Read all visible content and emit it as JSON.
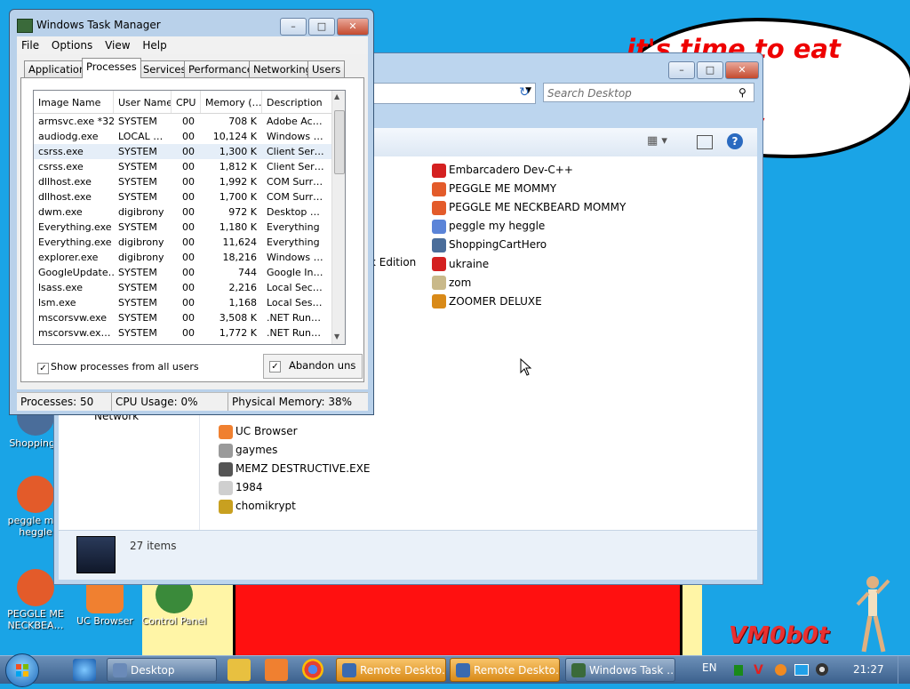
{
  "desktop": {
    "bubble_text": "it's time to eat shit\nand chew\ngum",
    "signature": "VM0b0t",
    "icons": [
      {
        "label": "ShoppingC"
      },
      {
        "label": "peggle m… heggle"
      },
      {
        "label": "PEGGLE ME NECKBEA…"
      },
      {
        "label": "UC Browser"
      },
      {
        "label": "Control Panel"
      }
    ]
  },
  "explorer": {
    "search_placeholder": "Search Desktop",
    "partial_text": "k Edition",
    "nav_network": "Network",
    "items_right": [
      {
        "label": "Embarcadero Dev-C++",
        "color": "#d42020"
      },
      {
        "label": "PEGGLE ME MOMMY",
        "color": "#e35b2a"
      },
      {
        "label": "PEGGLE ME NECKBEARD MOMMY",
        "color": "#e35b2a"
      },
      {
        "label": "peggle my heggle",
        "color": "#5b84d8"
      },
      {
        "label": "ShoppingCartHero",
        "color": "#4a6d9a"
      },
      {
        "label": "ukraine",
        "color": "#d42020"
      },
      {
        "label": "zom",
        "color": "#c9b98a"
      },
      {
        "label": "ZOOMER DELUXE",
        "color": "#d98a18"
      }
    ],
    "items_bottom": [
      {
        "label": "UC Browser",
        "color": "#f08030"
      },
      {
        "label": "gaymes",
        "color": "#9a9a9a"
      },
      {
        "label": "MEMZ DESTRUCTIVE.EXE",
        "color": "#555555"
      },
      {
        "label": "1984",
        "color": "#cfcfcf"
      },
      {
        "label": "chomikrypt",
        "color": "#c8a020"
      }
    ],
    "item_count": "27 items"
  },
  "task_manager": {
    "title": "Windows Task Manager",
    "menu": [
      "File",
      "Options",
      "View",
      "Help"
    ],
    "tabs": [
      "Applications",
      "Processes",
      "Services",
      "Performance",
      "Networking",
      "Users"
    ],
    "active_tab": "Processes",
    "columns": [
      "Image Name",
      "User Name",
      "CPU",
      "Memory (…",
      "Description"
    ],
    "rows": [
      {
        "image": "armsvc.exe *32",
        "user": "SYSTEM",
        "cpu": "00",
        "mem": "708 K",
        "desc": "Adobe Ac…"
      },
      {
        "image": "audiodg.exe",
        "user": "LOCAL …",
        "cpu": "00",
        "mem": "10,124 K",
        "desc": "Windows …"
      },
      {
        "image": "csrss.exe",
        "user": "SYSTEM",
        "cpu": "00",
        "mem": "1,300 K",
        "desc": "Client Ser…"
      },
      {
        "image": "csrss.exe",
        "user": "SYSTEM",
        "cpu": "00",
        "mem": "1,812 K",
        "desc": "Client Ser…"
      },
      {
        "image": "dllhost.exe",
        "user": "SYSTEM",
        "cpu": "00",
        "mem": "1,992 K",
        "desc": "COM Surr…"
      },
      {
        "image": "dllhost.exe",
        "user": "SYSTEM",
        "cpu": "00",
        "mem": "1,700 K",
        "desc": "COM Surr…"
      },
      {
        "image": "dwm.exe",
        "user": "digibrony",
        "cpu": "00",
        "mem": "972 K",
        "desc": "Desktop …"
      },
      {
        "image": "Everything.exe",
        "user": "SYSTEM",
        "cpu": "00",
        "mem": "1,180 K",
        "desc": "Everything"
      },
      {
        "image": "Everything.exe",
        "user": "digibrony",
        "cpu": "00",
        "mem": "11,624",
        "desc": "Everything"
      },
      {
        "image": "explorer.exe",
        "user": "digibrony",
        "cpu": "00",
        "mem": "18,216",
        "desc": "Windows …"
      },
      {
        "image": "GoogleUpdate…",
        "user": "SYSTEM",
        "cpu": "00",
        "mem": "744",
        "desc": "Google In…"
      },
      {
        "image": "lsass.exe",
        "user": "SYSTEM",
        "cpu": "00",
        "mem": "2,216",
        "desc": "Local Sec…"
      },
      {
        "image": "lsm.exe",
        "user": "SYSTEM",
        "cpu": "00",
        "mem": "1,168",
        "desc": "Local Ses…"
      },
      {
        "image": "mscorsvw.exe",
        "user": "SYSTEM",
        "cpu": "00",
        "mem": "3,508 K",
        "desc": ".NET Run…"
      },
      {
        "image": "mscorsvw.ex…",
        "user": "SYSTEM",
        "cpu": "00",
        "mem": "1,772 K",
        "desc": ".NET Run…"
      }
    ],
    "selected_row": 2,
    "show_all_label": "Show processes from all users",
    "abandon_label": "Abandon uns",
    "status": {
      "processes": "Processes: 50",
      "cpu": "CPU Usage: 0%",
      "memory": "Physical Memory: 38%"
    }
  },
  "taskbar": {
    "buttons": [
      {
        "label": "Desktop",
        "style": "normal"
      },
      {
        "label": "Remote Deskto…",
        "style": "orange"
      },
      {
        "label": "Remote Deskto…",
        "style": "orange"
      },
      {
        "label": "Windows Task …",
        "style": "normal"
      }
    ],
    "lang": "EN",
    "time": "21:27"
  }
}
